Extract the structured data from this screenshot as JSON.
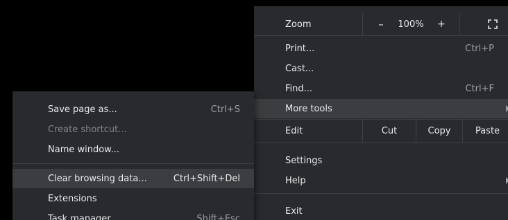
{
  "main_menu": {
    "zoom": {
      "label": "Zoom",
      "minus": "–",
      "level": "100%",
      "plus": "+",
      "fullscreen_icon": "fullscreen-icon"
    },
    "print": {
      "label": "Print...",
      "shortcut": "Ctrl+P"
    },
    "cast": {
      "label": "Cast..."
    },
    "find": {
      "label": "Find...",
      "shortcut": "Ctrl+F"
    },
    "more_tools": {
      "label": "More tools"
    },
    "edit": {
      "label": "Edit",
      "cut": "Cut",
      "copy": "Copy",
      "paste": "Paste"
    },
    "settings": {
      "label": "Settings"
    },
    "help": {
      "label": "Help"
    },
    "exit": {
      "label": "Exit"
    }
  },
  "more_tools_submenu": {
    "save_page": {
      "label": "Save page as...",
      "shortcut": "Ctrl+S"
    },
    "create_shortcut": {
      "label": "Create shortcut..."
    },
    "name_window": {
      "label": "Name window..."
    },
    "clear_browsing": {
      "label": "Clear browsing data...",
      "shortcut": "Ctrl+Shift+Del"
    },
    "extensions": {
      "label": "Extensions"
    },
    "task_manager": {
      "label": "Task manager",
      "shortcut": "Shift+Esc"
    }
  },
  "colors": {
    "menu_bg": "#292a2d",
    "hover_bg": "#3c3d40",
    "text": "#e8eaed",
    "muted_text": "#9aa0a6",
    "disabled_text": "#80868b"
  }
}
